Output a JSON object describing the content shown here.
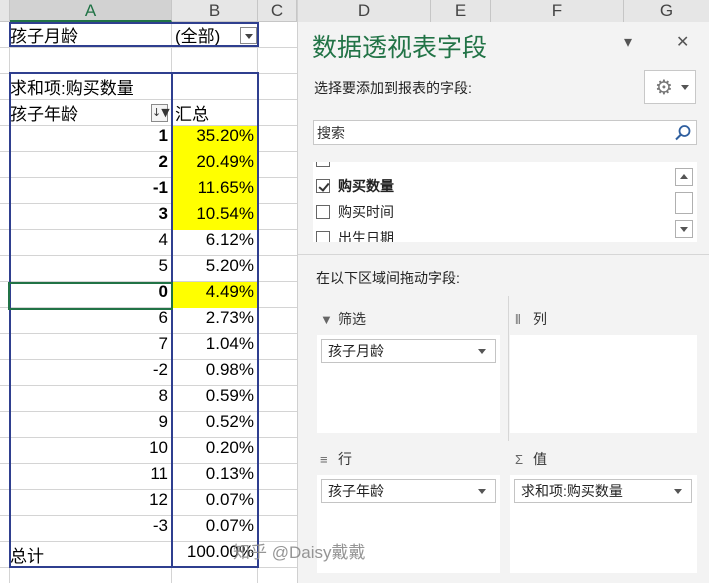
{
  "sheet": {
    "columns": [
      "A",
      "B",
      "C"
    ],
    "filter_row": {
      "label": "孩子月龄",
      "value": "(全部)"
    },
    "sum_header": "求和项:购买数量",
    "row_header": "孩子年龄",
    "value_header": "汇总",
    "rows": [
      {
        "key": "1",
        "value": "35.20%",
        "highlight": true,
        "bold": true
      },
      {
        "key": "2",
        "value": "20.49%",
        "highlight": true,
        "bold": true
      },
      {
        "key": "-1",
        "value": "11.65%",
        "highlight": true,
        "bold": true
      },
      {
        "key": "3",
        "value": "10.54%",
        "highlight": true,
        "bold": true
      },
      {
        "key": "4",
        "value": "6.12%",
        "highlight": false,
        "bold": false
      },
      {
        "key": "5",
        "value": "5.20%",
        "highlight": false,
        "bold": false
      },
      {
        "key": "0",
        "value": "4.49%",
        "highlight": true,
        "bold": true
      },
      {
        "key": "6",
        "value": "2.73%",
        "highlight": false,
        "bold": false
      },
      {
        "key": "7",
        "value": "1.04%",
        "highlight": false,
        "bold": false
      },
      {
        "key": "-2",
        "value": "0.98%",
        "highlight": false,
        "bold": false
      },
      {
        "key": "8",
        "value": "0.59%",
        "highlight": false,
        "bold": false
      },
      {
        "key": "9",
        "value": "0.52%",
        "highlight": false,
        "bold": false
      },
      {
        "key": "10",
        "value": "0.20%",
        "highlight": false,
        "bold": false
      },
      {
        "key": "11",
        "value": "0.13%",
        "highlight": false,
        "bold": false
      },
      {
        "key": "12",
        "value": "0.07%",
        "highlight": false,
        "bold": false
      },
      {
        "key": "-3",
        "value": "0.07%",
        "highlight": false,
        "bold": false
      }
    ],
    "total_label": "总计",
    "total_value": "100.00%"
  },
  "pane": {
    "columns": [
      "D",
      "E",
      "F",
      "G"
    ],
    "title": "数据透视表字段",
    "subtitle": "选择要添加到报表的字段:",
    "search_placeholder": "搜索",
    "fields": [
      {
        "label": "购买数量",
        "checked": true
      },
      {
        "label": "购买时间",
        "checked": false
      },
      {
        "label": "出生日期",
        "checked": false
      }
    ],
    "drag_label": "在以下区域间拖动字段:",
    "areas": {
      "filter": {
        "title": "筛选",
        "items": [
          "孩子月龄"
        ]
      },
      "columns": {
        "title": "列",
        "items": []
      },
      "rows": {
        "title": "行",
        "items": [
          "孩子年龄"
        ]
      },
      "values": {
        "title": "值",
        "items": [
          "求和项:购买数量"
        ]
      }
    }
  },
  "watermark": "知乎 @Daisy戴戴",
  "colors": {
    "accent": "#217346",
    "highlight": "#ffff00",
    "pivot_border": "#2f3f8f"
  }
}
